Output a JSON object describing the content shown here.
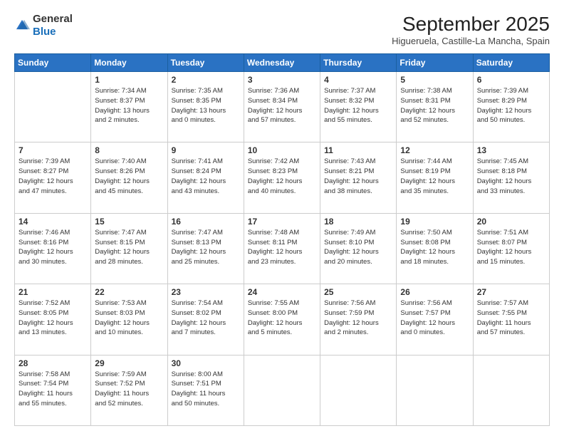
{
  "header": {
    "logo_line1": "General",
    "logo_line2": "Blue",
    "month": "September 2025",
    "location": "Higueruela, Castille-La Mancha, Spain"
  },
  "days_of_week": [
    "Sunday",
    "Monday",
    "Tuesday",
    "Wednesday",
    "Thursday",
    "Friday",
    "Saturday"
  ],
  "weeks": [
    [
      {
        "day": "",
        "info": ""
      },
      {
        "day": "1",
        "info": "Sunrise: 7:34 AM\nSunset: 8:37 PM\nDaylight: 13 hours\nand 2 minutes."
      },
      {
        "day": "2",
        "info": "Sunrise: 7:35 AM\nSunset: 8:35 PM\nDaylight: 13 hours\nand 0 minutes."
      },
      {
        "day": "3",
        "info": "Sunrise: 7:36 AM\nSunset: 8:34 PM\nDaylight: 12 hours\nand 57 minutes."
      },
      {
        "day": "4",
        "info": "Sunrise: 7:37 AM\nSunset: 8:32 PM\nDaylight: 12 hours\nand 55 minutes."
      },
      {
        "day": "5",
        "info": "Sunrise: 7:38 AM\nSunset: 8:31 PM\nDaylight: 12 hours\nand 52 minutes."
      },
      {
        "day": "6",
        "info": "Sunrise: 7:39 AM\nSunset: 8:29 PM\nDaylight: 12 hours\nand 50 minutes."
      }
    ],
    [
      {
        "day": "7",
        "info": "Sunrise: 7:39 AM\nSunset: 8:27 PM\nDaylight: 12 hours\nand 47 minutes."
      },
      {
        "day": "8",
        "info": "Sunrise: 7:40 AM\nSunset: 8:26 PM\nDaylight: 12 hours\nand 45 minutes."
      },
      {
        "day": "9",
        "info": "Sunrise: 7:41 AM\nSunset: 8:24 PM\nDaylight: 12 hours\nand 43 minutes."
      },
      {
        "day": "10",
        "info": "Sunrise: 7:42 AM\nSunset: 8:23 PM\nDaylight: 12 hours\nand 40 minutes."
      },
      {
        "day": "11",
        "info": "Sunrise: 7:43 AM\nSunset: 8:21 PM\nDaylight: 12 hours\nand 38 minutes."
      },
      {
        "day": "12",
        "info": "Sunrise: 7:44 AM\nSunset: 8:19 PM\nDaylight: 12 hours\nand 35 minutes."
      },
      {
        "day": "13",
        "info": "Sunrise: 7:45 AM\nSunset: 8:18 PM\nDaylight: 12 hours\nand 33 minutes."
      }
    ],
    [
      {
        "day": "14",
        "info": "Sunrise: 7:46 AM\nSunset: 8:16 PM\nDaylight: 12 hours\nand 30 minutes."
      },
      {
        "day": "15",
        "info": "Sunrise: 7:47 AM\nSunset: 8:15 PM\nDaylight: 12 hours\nand 28 minutes."
      },
      {
        "day": "16",
        "info": "Sunrise: 7:47 AM\nSunset: 8:13 PM\nDaylight: 12 hours\nand 25 minutes."
      },
      {
        "day": "17",
        "info": "Sunrise: 7:48 AM\nSunset: 8:11 PM\nDaylight: 12 hours\nand 23 minutes."
      },
      {
        "day": "18",
        "info": "Sunrise: 7:49 AM\nSunset: 8:10 PM\nDaylight: 12 hours\nand 20 minutes."
      },
      {
        "day": "19",
        "info": "Sunrise: 7:50 AM\nSunset: 8:08 PM\nDaylight: 12 hours\nand 18 minutes."
      },
      {
        "day": "20",
        "info": "Sunrise: 7:51 AM\nSunset: 8:07 PM\nDaylight: 12 hours\nand 15 minutes."
      }
    ],
    [
      {
        "day": "21",
        "info": "Sunrise: 7:52 AM\nSunset: 8:05 PM\nDaylight: 12 hours\nand 13 minutes."
      },
      {
        "day": "22",
        "info": "Sunrise: 7:53 AM\nSunset: 8:03 PM\nDaylight: 12 hours\nand 10 minutes."
      },
      {
        "day": "23",
        "info": "Sunrise: 7:54 AM\nSunset: 8:02 PM\nDaylight: 12 hours\nand 7 minutes."
      },
      {
        "day": "24",
        "info": "Sunrise: 7:55 AM\nSunset: 8:00 PM\nDaylight: 12 hours\nand 5 minutes."
      },
      {
        "day": "25",
        "info": "Sunrise: 7:56 AM\nSunset: 7:59 PM\nDaylight: 12 hours\nand 2 minutes."
      },
      {
        "day": "26",
        "info": "Sunrise: 7:56 AM\nSunset: 7:57 PM\nDaylight: 12 hours\nand 0 minutes."
      },
      {
        "day": "27",
        "info": "Sunrise: 7:57 AM\nSunset: 7:55 PM\nDaylight: 11 hours\nand 57 minutes."
      }
    ],
    [
      {
        "day": "28",
        "info": "Sunrise: 7:58 AM\nSunset: 7:54 PM\nDaylight: 11 hours\nand 55 minutes."
      },
      {
        "day": "29",
        "info": "Sunrise: 7:59 AM\nSunset: 7:52 PM\nDaylight: 11 hours\nand 52 minutes."
      },
      {
        "day": "30",
        "info": "Sunrise: 8:00 AM\nSunset: 7:51 PM\nDaylight: 11 hours\nand 50 minutes."
      },
      {
        "day": "",
        "info": ""
      },
      {
        "day": "",
        "info": ""
      },
      {
        "day": "",
        "info": ""
      },
      {
        "day": "",
        "info": ""
      }
    ]
  ]
}
